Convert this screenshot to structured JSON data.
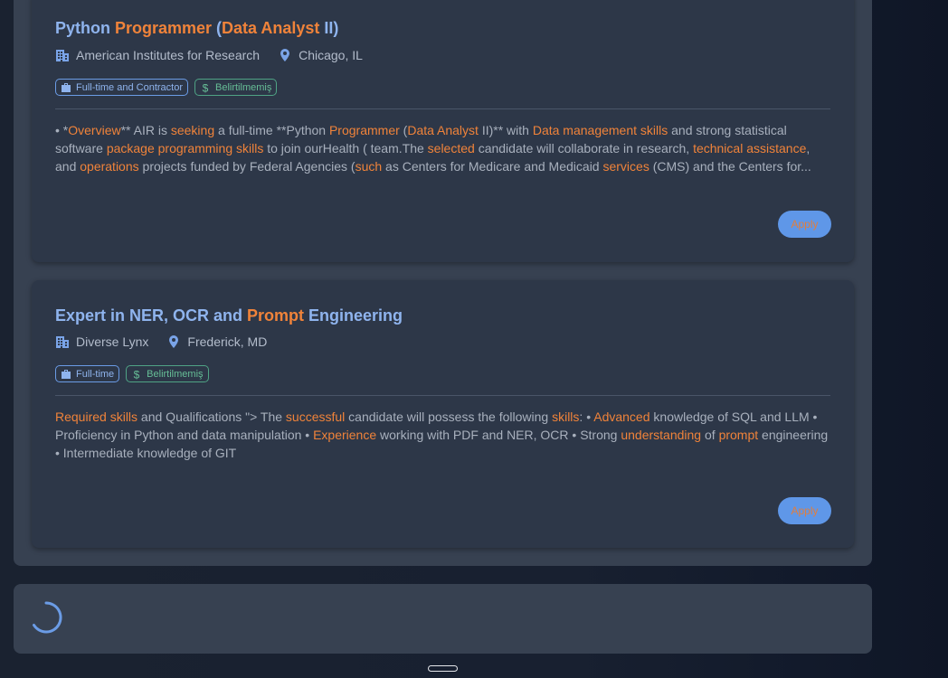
{
  "jobs": [
    {
      "title_parts": [
        {
          "text": "Python ",
          "hl": false
        },
        {
          "text": "Programmer",
          "hl": true
        },
        {
          "text": " (",
          "hl": false
        },
        {
          "text": "Data Analyst",
          "hl": true
        },
        {
          "text": " II)",
          "hl": false
        }
      ],
      "company": "American Institutes for Research",
      "location": "Chicago, IL",
      "employment_type": "Full-time and Contractor",
      "salary": "Belirtilmemiş",
      "description_lines": [
        [
          {
            "text": "• *",
            "hl": false
          },
          {
            "text": "Overview",
            "hl": true
          },
          {
            "text": "** AIR is ",
            "hl": false
          },
          {
            "text": "seeking",
            "hl": true
          },
          {
            "text": " a full-time **Python ",
            "hl": false
          },
          {
            "text": "Programmer",
            "hl": true
          },
          {
            "text": " (",
            "hl": false
          },
          {
            "text": "Data Analyst",
            "hl": true
          },
          {
            "text": " II)** with ",
            "hl": false
          },
          {
            "text": "Data management skills",
            "hl": true
          },
          {
            "text": " and strong statistical",
            "hl": false
          }
        ],
        [
          {
            "text": "software ",
            "hl": false
          },
          {
            "text": "package programming skills",
            "hl": true
          },
          {
            "text": " to join ourHealth ( team.The ",
            "hl": false
          },
          {
            "text": "selected",
            "hl": true
          },
          {
            "text": " candidate will collaborate in research, ",
            "hl": false
          },
          {
            "text": "technical assistance",
            "hl": true
          },
          {
            "text": ",",
            "hl": false
          }
        ],
        [
          {
            "text": "and ",
            "hl": false
          },
          {
            "text": "operations",
            "hl": true
          },
          {
            "text": " projects funded by Federal Agencies (",
            "hl": false
          },
          {
            "text": "such",
            "hl": true
          },
          {
            "text": " as Centers for Medicare and Medicaid ",
            "hl": false
          },
          {
            "text": "services",
            "hl": true
          },
          {
            "text": " (CMS) and the Centers for...",
            "hl": false
          }
        ]
      ],
      "apply_label": "Apply"
    },
    {
      "title_parts": [
        {
          "text": "Expert in NER, OCR and ",
          "hl": false
        },
        {
          "text": "Prompt",
          "hl": true
        },
        {
          "text": " Engineering",
          "hl": false
        }
      ],
      "company": "Diverse Lynx",
      "location": "Frederick, MD",
      "employment_type": "Full-time",
      "salary": "Belirtilmemiş",
      "description_lines": [
        [
          {
            "text": "Required skills",
            "hl": true
          },
          {
            "text": " and Qualifications \"> The ",
            "hl": false
          },
          {
            "text": "successful",
            "hl": true
          },
          {
            "text": " candidate will possess the following ",
            "hl": false
          },
          {
            "text": "skills",
            "hl": true
          },
          {
            "text": ": • ",
            "hl": false
          },
          {
            "text": "Advanced",
            "hl": true
          },
          {
            "text": " knowledge of SQL and LLM •",
            "hl": false
          }
        ],
        [
          {
            "text": "Proficiency in Python and data manipulation • ",
            "hl": false
          },
          {
            "text": "Experience",
            "hl": true
          },
          {
            "text": " working with PDF and NER, OCR • Strong ",
            "hl": false
          },
          {
            "text": "understanding",
            "hl": true
          },
          {
            "text": " of ",
            "hl": false
          },
          {
            "text": "prompt",
            "hl": true
          },
          {
            "text": " engineering",
            "hl": false
          }
        ],
        [
          {
            "text": "• Intermediate knowledge of GIT",
            "hl": false
          }
        ]
      ],
      "apply_label": "Apply"
    }
  ],
  "icons": {
    "company": "building-icon",
    "location": "map-pin-icon",
    "employment_type": "briefcase-icon",
    "salary": "dollar-icon",
    "loading": "spinner-icon"
  },
  "colors": {
    "title": "#8fb4ee",
    "highlight": "#f0833a",
    "accent_blue": "#5f97e8",
    "salary_green": "#66bd96"
  }
}
